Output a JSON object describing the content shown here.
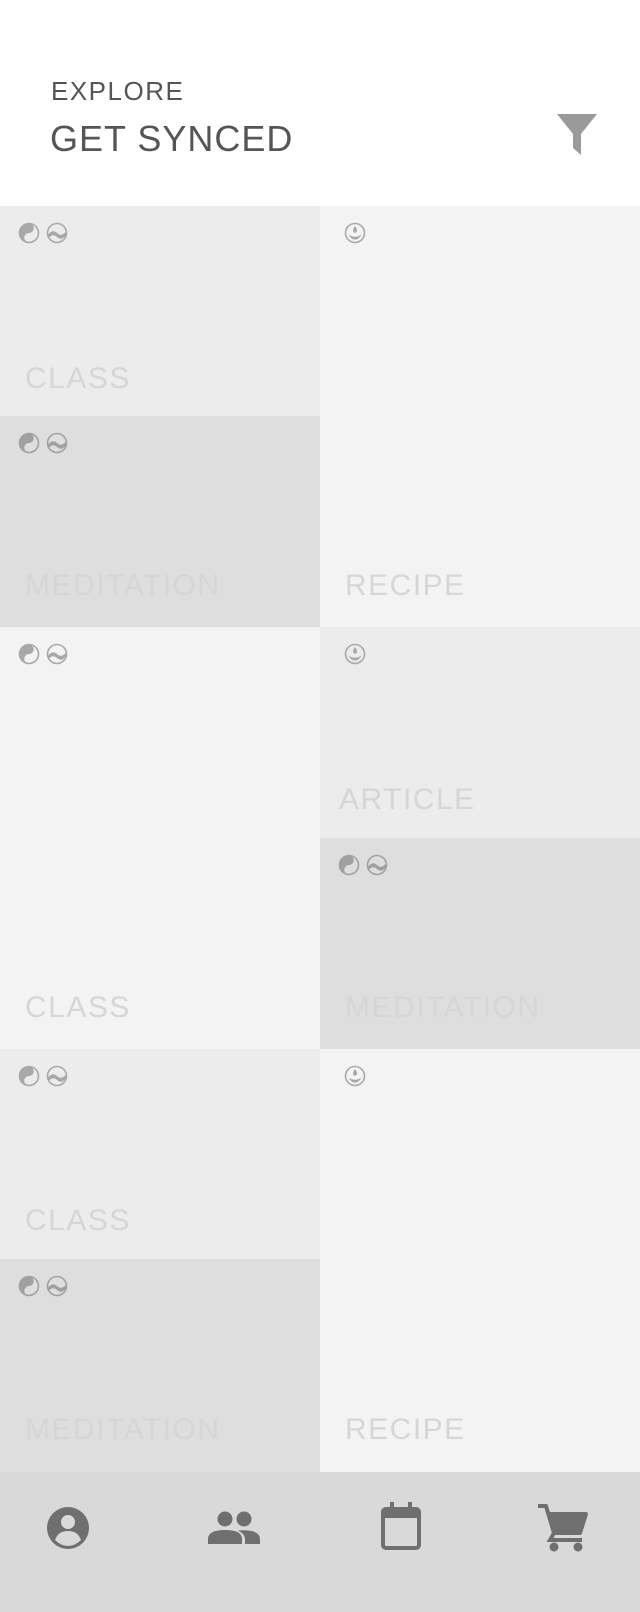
{
  "header": {
    "eyebrow": "EXPLORE",
    "title": "GET SYNCED",
    "filter_icon": "filter-icon"
  },
  "cards": [
    {
      "label": "CLASS",
      "icons": [
        "yin-yang-icon",
        "wave-icon"
      ],
      "bg": "#ececec"
    },
    {
      "label": "MEDITATION",
      "icons": [
        "yin-yang-icon",
        "wave-icon"
      ],
      "bg": "#dedede"
    },
    {
      "label": "RECIPE",
      "icons": [
        "drop-icon"
      ],
      "bg": "#f3f3f3"
    },
    {
      "label": "CLASS",
      "icons": [
        "yin-yang-icon",
        "wave-icon"
      ],
      "bg": "#f3f3f3"
    },
    {
      "label": "ARTICLE",
      "icons": [
        "drop-icon"
      ],
      "bg": "#ececec"
    },
    {
      "label": "MEDITATION",
      "icons": [
        "yin-yang-icon",
        "wave-icon"
      ],
      "bg": "#dedede"
    },
    {
      "label": "CLASS",
      "icons": [
        "yin-yang-icon",
        "wave-icon"
      ],
      "bg": "#ececec"
    },
    {
      "label": "RECIPE",
      "icons": [
        "drop-icon"
      ],
      "bg": "#f3f3f3"
    },
    {
      "label": "MEDITATION",
      "icons": [
        "yin-yang-icon",
        "wave-icon"
      ],
      "bg": "#dedede"
    }
  ],
  "nav": {
    "items": [
      {
        "icon": "account-icon"
      },
      {
        "icon": "people-icon"
      },
      {
        "icon": "calendar-icon"
      },
      {
        "icon": "cart-icon"
      }
    ],
    "bg": "#d9d9d9"
  }
}
